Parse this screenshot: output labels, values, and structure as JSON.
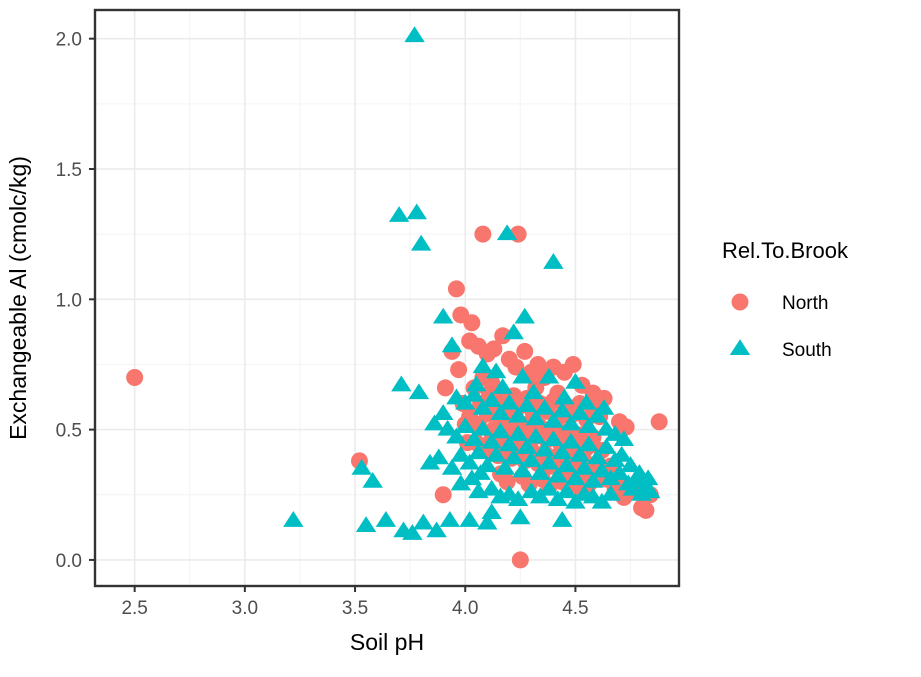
{
  "chart_data": {
    "type": "scatter",
    "title": "",
    "xlabel": "Soil pH",
    "ylabel": "Exchangeable Al (cmolc/kg)",
    "xlim": [
      2.32,
      4.97
    ],
    "ylim": [
      -0.1,
      2.11
    ],
    "xticks": [
      "2.5",
      "3.0",
      "3.5",
      "4.0",
      "4.5"
    ],
    "xtick_values": [
      2.5,
      3.0,
      3.5,
      4.0,
      4.5
    ],
    "yticks": [
      "0.0",
      "0.5",
      "1.0",
      "1.5",
      "2.0"
    ],
    "ytick_values": [
      0.0,
      0.5,
      1.0,
      1.5,
      2.0
    ],
    "grid": true,
    "grid_major_color": "#ebebeb",
    "grid_minor_color": "#f5f5f5",
    "panel_background": "#ffffff",
    "panel_border_color": "#333333",
    "legend_position": "right",
    "legend": {
      "title": "Rel.To.Brook",
      "entries": [
        {
          "name": "North",
          "color": "#F8766D",
          "marker": "circle"
        },
        {
          "name": "South",
          "color": "#00BFC4",
          "marker": "triangle"
        }
      ]
    },
    "series": [
      {
        "name": "North",
        "color": "#F8766D",
        "marker": "circle",
        "points": [
          [
            2.5,
            0.7
          ],
          [
            3.52,
            0.38
          ],
          [
            3.9,
            0.25
          ],
          [
            4.08,
            1.25
          ],
          [
            4.24,
            1.25
          ],
          [
            4.25,
            0.0
          ],
          [
            4.88,
            0.53
          ],
          [
            3.96,
            1.04
          ],
          [
            3.98,
            0.94
          ],
          [
            4.03,
            0.91
          ],
          [
            4.02,
            0.84
          ],
          [
            3.91,
            0.66
          ],
          [
            3.97,
            0.73
          ],
          [
            3.94,
            0.8
          ],
          [
            4.06,
            0.82
          ],
          [
            4.1,
            0.79
          ],
          [
            4.13,
            0.81
          ],
          [
            4.17,
            0.86
          ],
          [
            4.2,
            0.77
          ],
          [
            4.23,
            0.74
          ],
          [
            4.27,
            0.8
          ],
          [
            4.3,
            0.72
          ],
          [
            4.33,
            0.75
          ],
          [
            4.36,
            0.7
          ],
          [
            4.4,
            0.74
          ],
          [
            4.45,
            0.72
          ],
          [
            4.49,
            0.75
          ],
          [
            4.53,
            0.67
          ],
          [
            4.58,
            0.64
          ],
          [
            4.63,
            0.62
          ],
          [
            4.04,
            0.66
          ],
          [
            4.07,
            0.6
          ],
          [
            4.11,
            0.64
          ],
          [
            4.14,
            0.58
          ],
          [
            4.17,
            0.62
          ],
          [
            4.2,
            0.57
          ],
          [
            4.22,
            0.63
          ],
          [
            4.25,
            0.59
          ],
          [
            4.28,
            0.62
          ],
          [
            4.31,
            0.56
          ],
          [
            4.34,
            0.6
          ],
          [
            4.37,
            0.57
          ],
          [
            4.4,
            0.61
          ],
          [
            4.43,
            0.55
          ],
          [
            4.46,
            0.59
          ],
          [
            4.49,
            0.56
          ],
          [
            4.52,
            0.6
          ],
          [
            4.55,
            0.54
          ],
          [
            4.58,
            0.58
          ],
          [
            4.61,
            0.55
          ],
          [
            4.02,
            0.55
          ],
          [
            4.06,
            0.52
          ],
          [
            4.1,
            0.56
          ],
          [
            4.13,
            0.5
          ],
          [
            4.16,
            0.54
          ],
          [
            4.19,
            0.49
          ],
          [
            4.22,
            0.53
          ],
          [
            4.25,
            0.48
          ],
          [
            4.28,
            0.52
          ],
          [
            4.31,
            0.47
          ],
          [
            4.34,
            0.51
          ],
          [
            4.37,
            0.46
          ],
          [
            4.4,
            0.5
          ],
          [
            4.43,
            0.45
          ],
          [
            4.46,
            0.49
          ],
          [
            4.49,
            0.44
          ],
          [
            4.52,
            0.48
          ],
          [
            4.55,
            0.43
          ],
          [
            4.58,
            0.47
          ],
          [
            4.62,
            0.42
          ],
          [
            4.05,
            0.45
          ],
          [
            4.09,
            0.42
          ],
          [
            4.12,
            0.46
          ],
          [
            4.15,
            0.4
          ],
          [
            4.18,
            0.44
          ],
          [
            4.21,
            0.39
          ],
          [
            4.24,
            0.43
          ],
          [
            4.27,
            0.38
          ],
          [
            4.3,
            0.42
          ],
          [
            4.33,
            0.37
          ],
          [
            4.36,
            0.41
          ],
          [
            4.39,
            0.36
          ],
          [
            4.42,
            0.4
          ],
          [
            4.45,
            0.35
          ],
          [
            4.48,
            0.39
          ],
          [
            4.51,
            0.34
          ],
          [
            4.54,
            0.38
          ],
          [
            4.57,
            0.33
          ],
          [
            4.6,
            0.37
          ],
          [
            4.66,
            0.36
          ],
          [
            4.7,
            0.3
          ],
          [
            4.74,
            0.28
          ],
          [
            4.78,
            0.26
          ],
          [
            4.8,
            0.2
          ],
          [
            4.82,
            0.19
          ],
          [
            4.84,
            0.25
          ],
          [
            4.68,
            0.27
          ],
          [
            4.72,
            0.24
          ],
          [
            4.64,
            0.31
          ],
          [
            4.44,
            0.3
          ],
          [
            4.47,
            0.28
          ],
          [
            4.5,
            0.31
          ],
          [
            4.53,
            0.27
          ],
          [
            4.56,
            0.29
          ],
          [
            4.35,
            0.31
          ],
          [
            4.38,
            0.28
          ],
          [
            4.26,
            0.32
          ],
          [
            4.29,
            0.29
          ],
          [
            4.16,
            0.33
          ],
          [
            4.19,
            0.3
          ],
          [
            3.99,
            0.6
          ],
          [
            4.0,
            0.52
          ],
          [
            4.01,
            0.45
          ],
          [
            4.08,
            0.7
          ],
          [
            4.12,
            0.68
          ],
          [
            4.32,
            0.66
          ],
          [
            4.42,
            0.64
          ],
          [
            4.6,
            0.62
          ],
          [
            4.7,
            0.53
          ],
          [
            4.73,
            0.51
          ]
        ]
      },
      {
        "name": "South",
        "color": "#00BFC4",
        "marker": "triangle",
        "points": [
          [
            3.77,
            2.01
          ],
          [
            3.7,
            1.32
          ],
          [
            3.78,
            1.33
          ],
          [
            3.8,
            1.21
          ],
          [
            4.19,
            1.25
          ],
          [
            4.4,
            1.14
          ],
          [
            3.9,
            0.93
          ],
          [
            4.27,
            0.93
          ],
          [
            3.71,
            0.67
          ],
          [
            3.79,
            0.64
          ],
          [
            3.22,
            0.15
          ],
          [
            3.53,
            0.35
          ],
          [
            3.58,
            0.3
          ],
          [
            3.55,
            0.13
          ],
          [
            3.64,
            0.15
          ],
          [
            3.72,
            0.11
          ],
          [
            3.76,
            0.1
          ],
          [
            3.81,
            0.14
          ],
          [
            3.87,
            0.11
          ],
          [
            3.93,
            0.15
          ],
          [
            4.02,
            0.15
          ],
          [
            4.1,
            0.14
          ],
          [
            3.88,
            0.39
          ],
          [
            3.94,
            0.82
          ],
          [
            4.22,
            0.87
          ],
          [
            4.08,
            0.74
          ],
          [
            4.14,
            0.72
          ],
          [
            4.26,
            0.7
          ],
          [
            4.38,
            0.7
          ],
          [
            4.5,
            0.68
          ],
          [
            3.96,
            0.62
          ],
          [
            4.0,
            0.6
          ],
          [
            4.04,
            0.63
          ],
          [
            4.08,
            0.58
          ],
          [
            4.12,
            0.61
          ],
          [
            4.16,
            0.56
          ],
          [
            4.2,
            0.6
          ],
          [
            4.24,
            0.55
          ],
          [
            4.28,
            0.59
          ],
          [
            4.32,
            0.54
          ],
          [
            4.36,
            0.58
          ],
          [
            4.4,
            0.53
          ],
          [
            4.44,
            0.57
          ],
          [
            4.48,
            0.52
          ],
          [
            4.52,
            0.56
          ],
          [
            4.56,
            0.51
          ],
          [
            4.6,
            0.55
          ],
          [
            4.64,
            0.5
          ],
          [
            4.68,
            0.48
          ],
          [
            4.72,
            0.46
          ],
          [
            3.92,
            0.5
          ],
          [
            3.96,
            0.47
          ],
          [
            4.0,
            0.51
          ],
          [
            4.04,
            0.46
          ],
          [
            4.08,
            0.5
          ],
          [
            4.12,
            0.45
          ],
          [
            4.16,
            0.49
          ],
          [
            4.2,
            0.44
          ],
          [
            4.24,
            0.48
          ],
          [
            4.28,
            0.43
          ],
          [
            4.32,
            0.47
          ],
          [
            4.36,
            0.42
          ],
          [
            4.4,
            0.46
          ],
          [
            4.44,
            0.41
          ],
          [
            4.48,
            0.45
          ],
          [
            4.52,
            0.4
          ],
          [
            4.56,
            0.44
          ],
          [
            4.6,
            0.39
          ],
          [
            4.64,
            0.43
          ],
          [
            4.68,
            0.38
          ],
          [
            3.98,
            0.4
          ],
          [
            4.02,
            0.37
          ],
          [
            4.06,
            0.41
          ],
          [
            4.1,
            0.36
          ],
          [
            4.14,
            0.4
          ],
          [
            4.18,
            0.35
          ],
          [
            4.22,
            0.39
          ],
          [
            4.26,
            0.34
          ],
          [
            4.3,
            0.38
          ],
          [
            4.34,
            0.33
          ],
          [
            4.38,
            0.37
          ],
          [
            4.42,
            0.32
          ],
          [
            4.46,
            0.36
          ],
          [
            4.5,
            0.31
          ],
          [
            4.54,
            0.35
          ],
          [
            4.58,
            0.3
          ],
          [
            4.62,
            0.34
          ],
          [
            4.66,
            0.31
          ],
          [
            4.7,
            0.33
          ],
          [
            4.74,
            0.29
          ],
          [
            4.76,
            0.27
          ],
          [
            4.78,
            0.3
          ],
          [
            4.8,
            0.25
          ],
          [
            4.82,
            0.28
          ],
          [
            4.84,
            0.26
          ],
          [
            4.3,
            0.26
          ],
          [
            4.34,
            0.24
          ],
          [
            4.38,
            0.27
          ],
          [
            4.42,
            0.23
          ],
          [
            4.46,
            0.26
          ],
          [
            4.5,
            0.22
          ],
          [
            4.54,
            0.25
          ],
          [
            4.58,
            0.24
          ],
          [
            4.62,
            0.22
          ],
          [
            4.66,
            0.25
          ],
          [
            4.2,
            0.25
          ],
          [
            4.24,
            0.23
          ],
          [
            4.12,
            0.27
          ],
          [
            4.16,
            0.24
          ],
          [
            4.06,
            0.26
          ],
          [
            4.44,
            0.15
          ],
          [
            4.25,
            0.16
          ],
          [
            4.12,
            0.18
          ],
          [
            3.84,
            0.37
          ],
          [
            3.86,
            0.52
          ],
          [
            4.05,
            0.67
          ],
          [
            4.17,
            0.66
          ],
          [
            4.31,
            0.64
          ],
          [
            4.45,
            0.62
          ],
          [
            4.55,
            0.6
          ],
          [
            4.63,
            0.58
          ],
          [
            4.71,
            0.4
          ],
          [
            4.75,
            0.36
          ],
          [
            4.79,
            0.33
          ],
          [
            4.83,
            0.31
          ],
          [
            3.9,
            0.56
          ],
          [
            3.94,
            0.35
          ],
          [
            3.98,
            0.29
          ],
          [
            4.03,
            0.31
          ],
          [
            4.07,
            0.33
          ]
        ]
      }
    ]
  }
}
